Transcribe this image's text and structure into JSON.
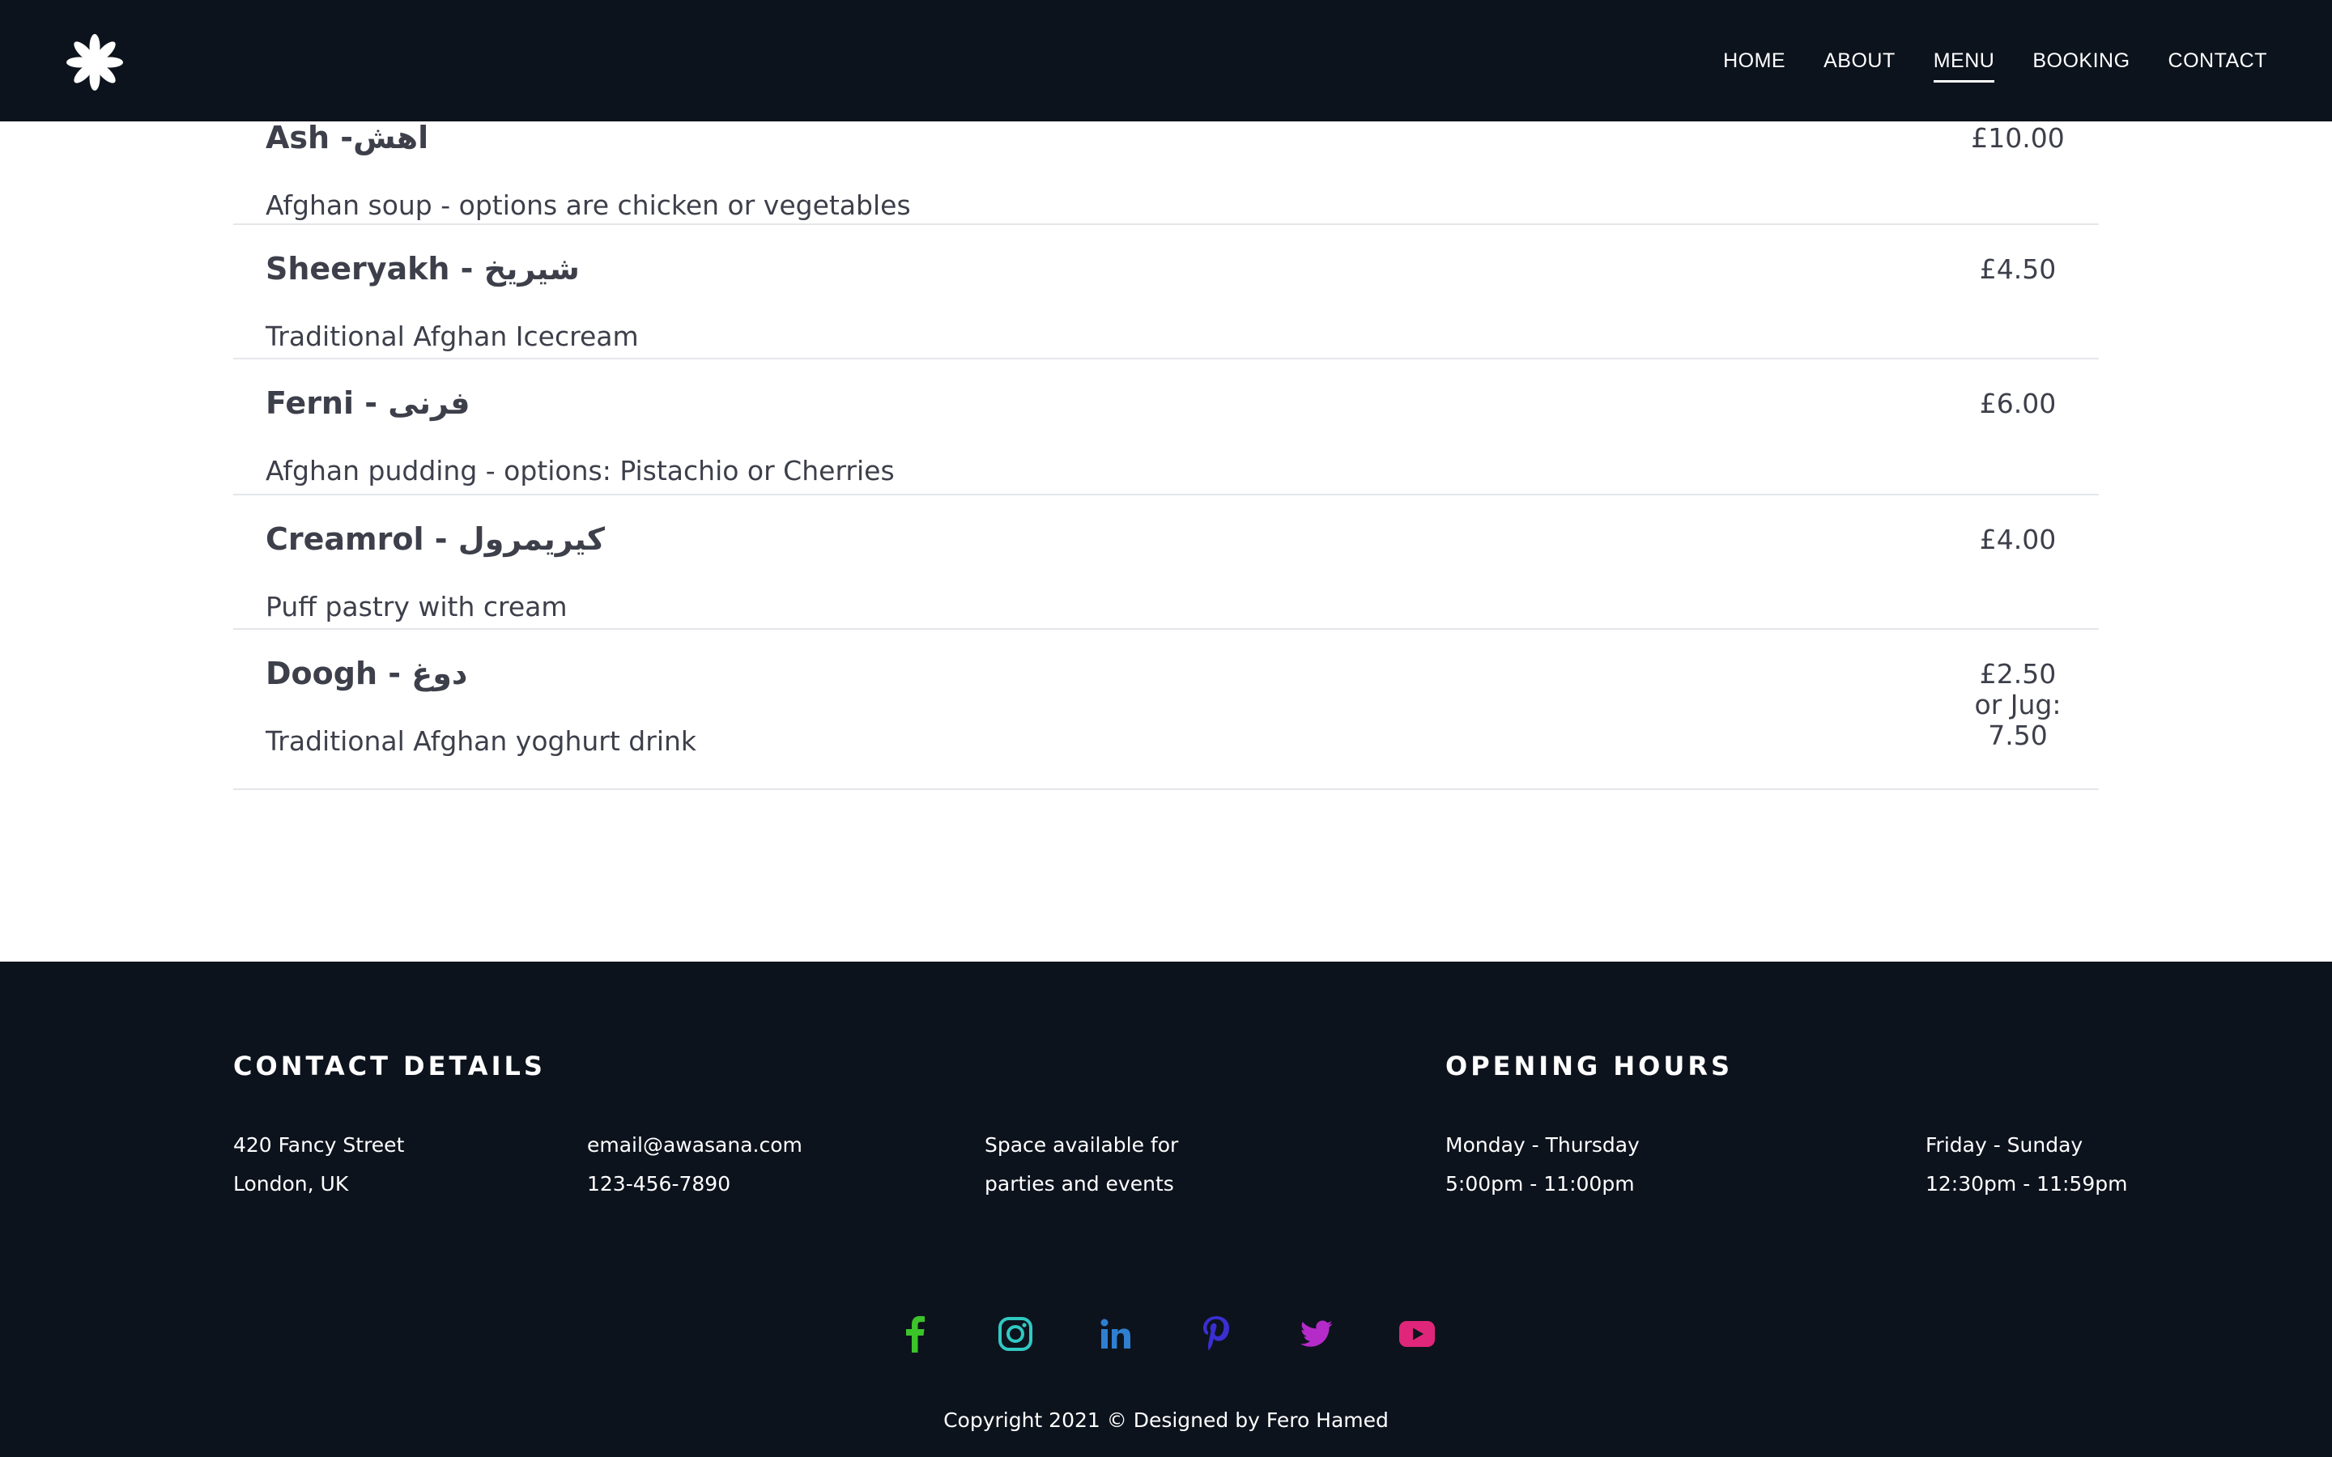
{
  "nav": {
    "items": [
      {
        "label": "HOME"
      },
      {
        "label": "ABOUT"
      },
      {
        "label": "MENU"
      },
      {
        "label": "BOOKING"
      },
      {
        "label": "CONTACT"
      }
    ],
    "active": "MENU"
  },
  "menu": {
    "items": [
      {
        "name": "Ash -اهش",
        "description": "Afghan soup - options are chicken or vegetables",
        "price": "£10.00"
      },
      {
        "name": "Sheeryakh - شیریخ",
        "description": "Traditional Afghan Icecream",
        "price": "£4.50"
      },
      {
        "name": "Ferni - فرنی",
        "description": "Afghan pudding - options: Pistachio or Cherries",
        "price": "£6.00"
      },
      {
        "name": "Creamrol - کیریمرول",
        "description": "Puff pastry with cream",
        "price": "£4.00"
      },
      {
        "name": "Doogh - دوغ",
        "description": "Traditional Afghan yoghurt drink",
        "price": "£2.50 or Jug: 7.50"
      }
    ]
  },
  "footer": {
    "contact_heading": "CONTACT DETAILS",
    "address_line1": "420 Fancy Street",
    "address_line2": "London, UK",
    "email": "email@awasana.com",
    "phone": "123-456-7890",
    "events_line1": "Space available for",
    "events_line2": "parties and events",
    "hours_heading": "OPENING HOURS",
    "weekday_label": "Monday - Thursday",
    "weekday_hours": "5:00pm - 11:00pm",
    "weekend_label": "Friday - Sunday",
    "weekend_hours": "12:30pm - 11:59pm",
    "copyright": "Copyright 2021 © Designed by Fero Hamed"
  },
  "social": [
    {
      "icon": "facebook-icon",
      "color": "#3cc42a"
    },
    {
      "icon": "instagram-icon",
      "color": "#2fc9c2"
    },
    {
      "icon": "linkedin-icon",
      "color": "#2f7fd1"
    },
    {
      "icon": "pinterest-icon",
      "color": "#3a2fd1"
    },
    {
      "icon": "twitter-icon",
      "color": "#b52bc9"
    },
    {
      "icon": "youtube-icon",
      "color": "#e0267a"
    }
  ],
  "colors": {
    "header_bg": "#0d131d",
    "footer_bg": "#0d131d",
    "text": "#3d3f4a",
    "divider": "#e5e6e9"
  }
}
